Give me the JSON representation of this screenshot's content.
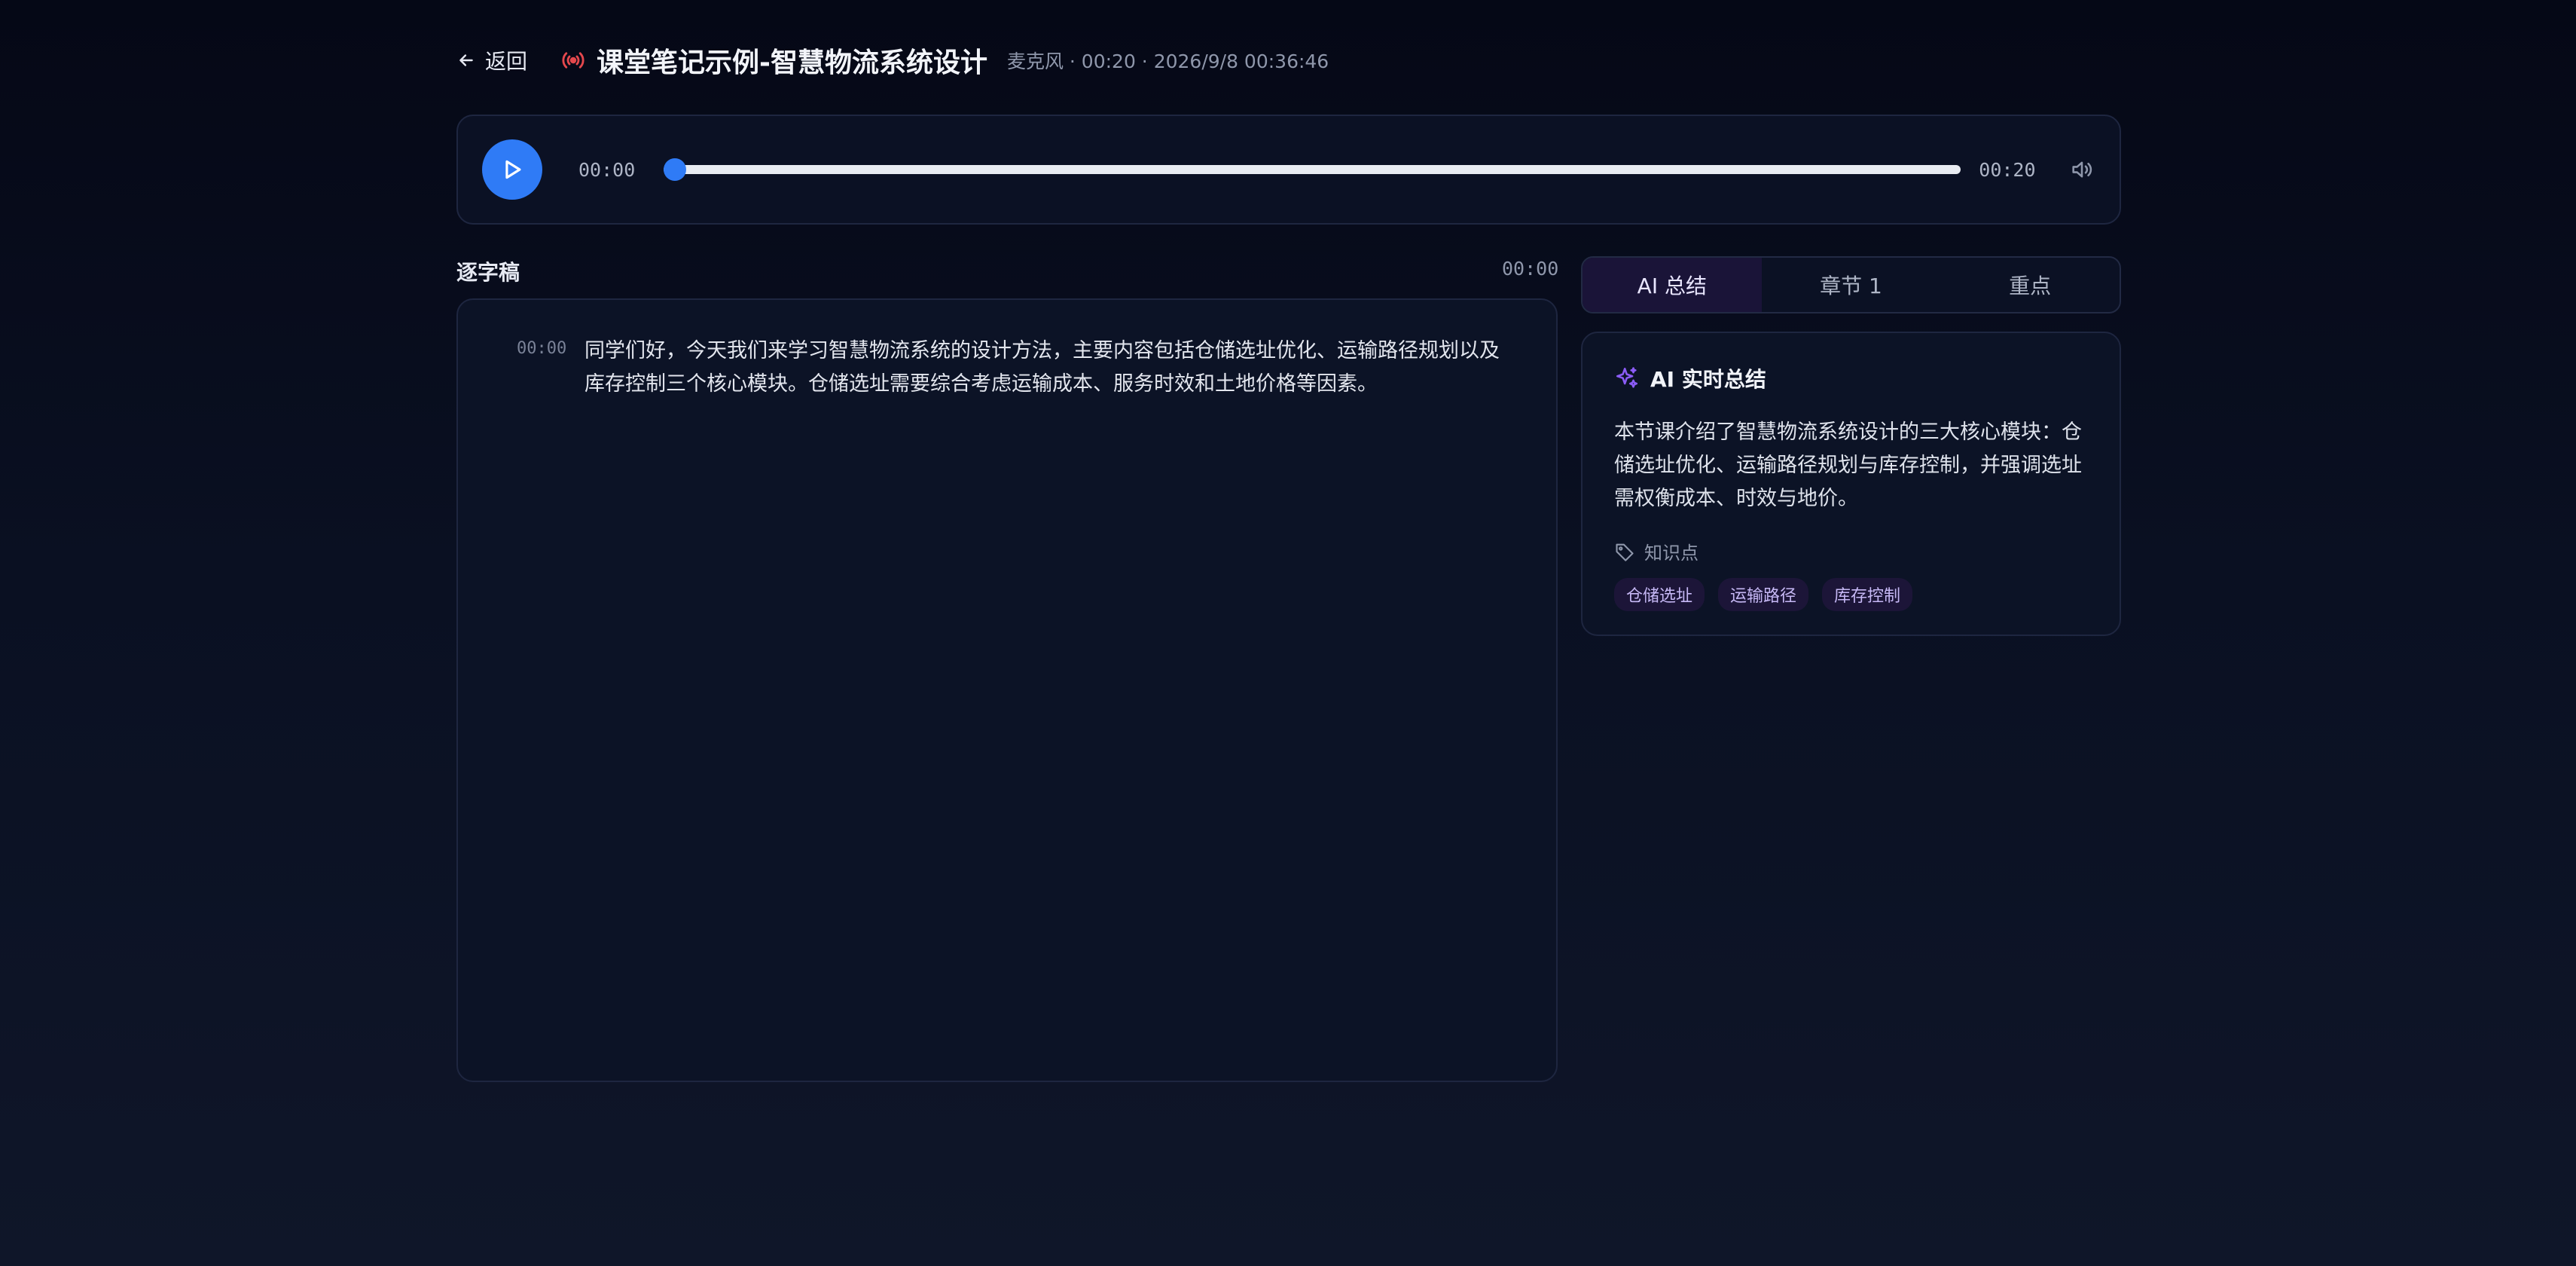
{
  "header": {
    "back_label": "返回",
    "title": "课堂笔记示例-智慧物流系统设计",
    "meta": "麦克风 · 00:20 · 2026/9/8 00:36:46"
  },
  "player": {
    "current_time": "00:00",
    "total_time": "00:20",
    "progress": 0
  },
  "transcript": {
    "title": "逐字稿",
    "current_time": "00:00",
    "segments": [
      {
        "time": "00:00",
        "text": "同学们好，今天我们来学习智慧物流系统的设计方法，主要内容包括仓储选址优化、运输路径规划以及库存控制三个核心模块。仓储选址需要综合考虑运输成本、服务时效和土地价格等因素。"
      }
    ]
  },
  "tabs": [
    {
      "label": "AI 总结",
      "active": true
    },
    {
      "label": "章节 1",
      "active": false
    },
    {
      "label": "重点",
      "active": false
    }
  ],
  "summary": {
    "title": "AI 实时总结",
    "body": "本节课介绍了智慧物流系统设计的三大核心模块：仓储选址优化、运输路径规划与库存控制，并强调选址需权衡成本、时效与地价。",
    "knowledge_label": "知识点",
    "tags": [
      "仓储选址",
      "运输路径",
      "库存控制"
    ]
  },
  "colors": {
    "accent": "#2f7bf6",
    "record": "#e5484d",
    "ai_purple": "#8b5cf6"
  }
}
